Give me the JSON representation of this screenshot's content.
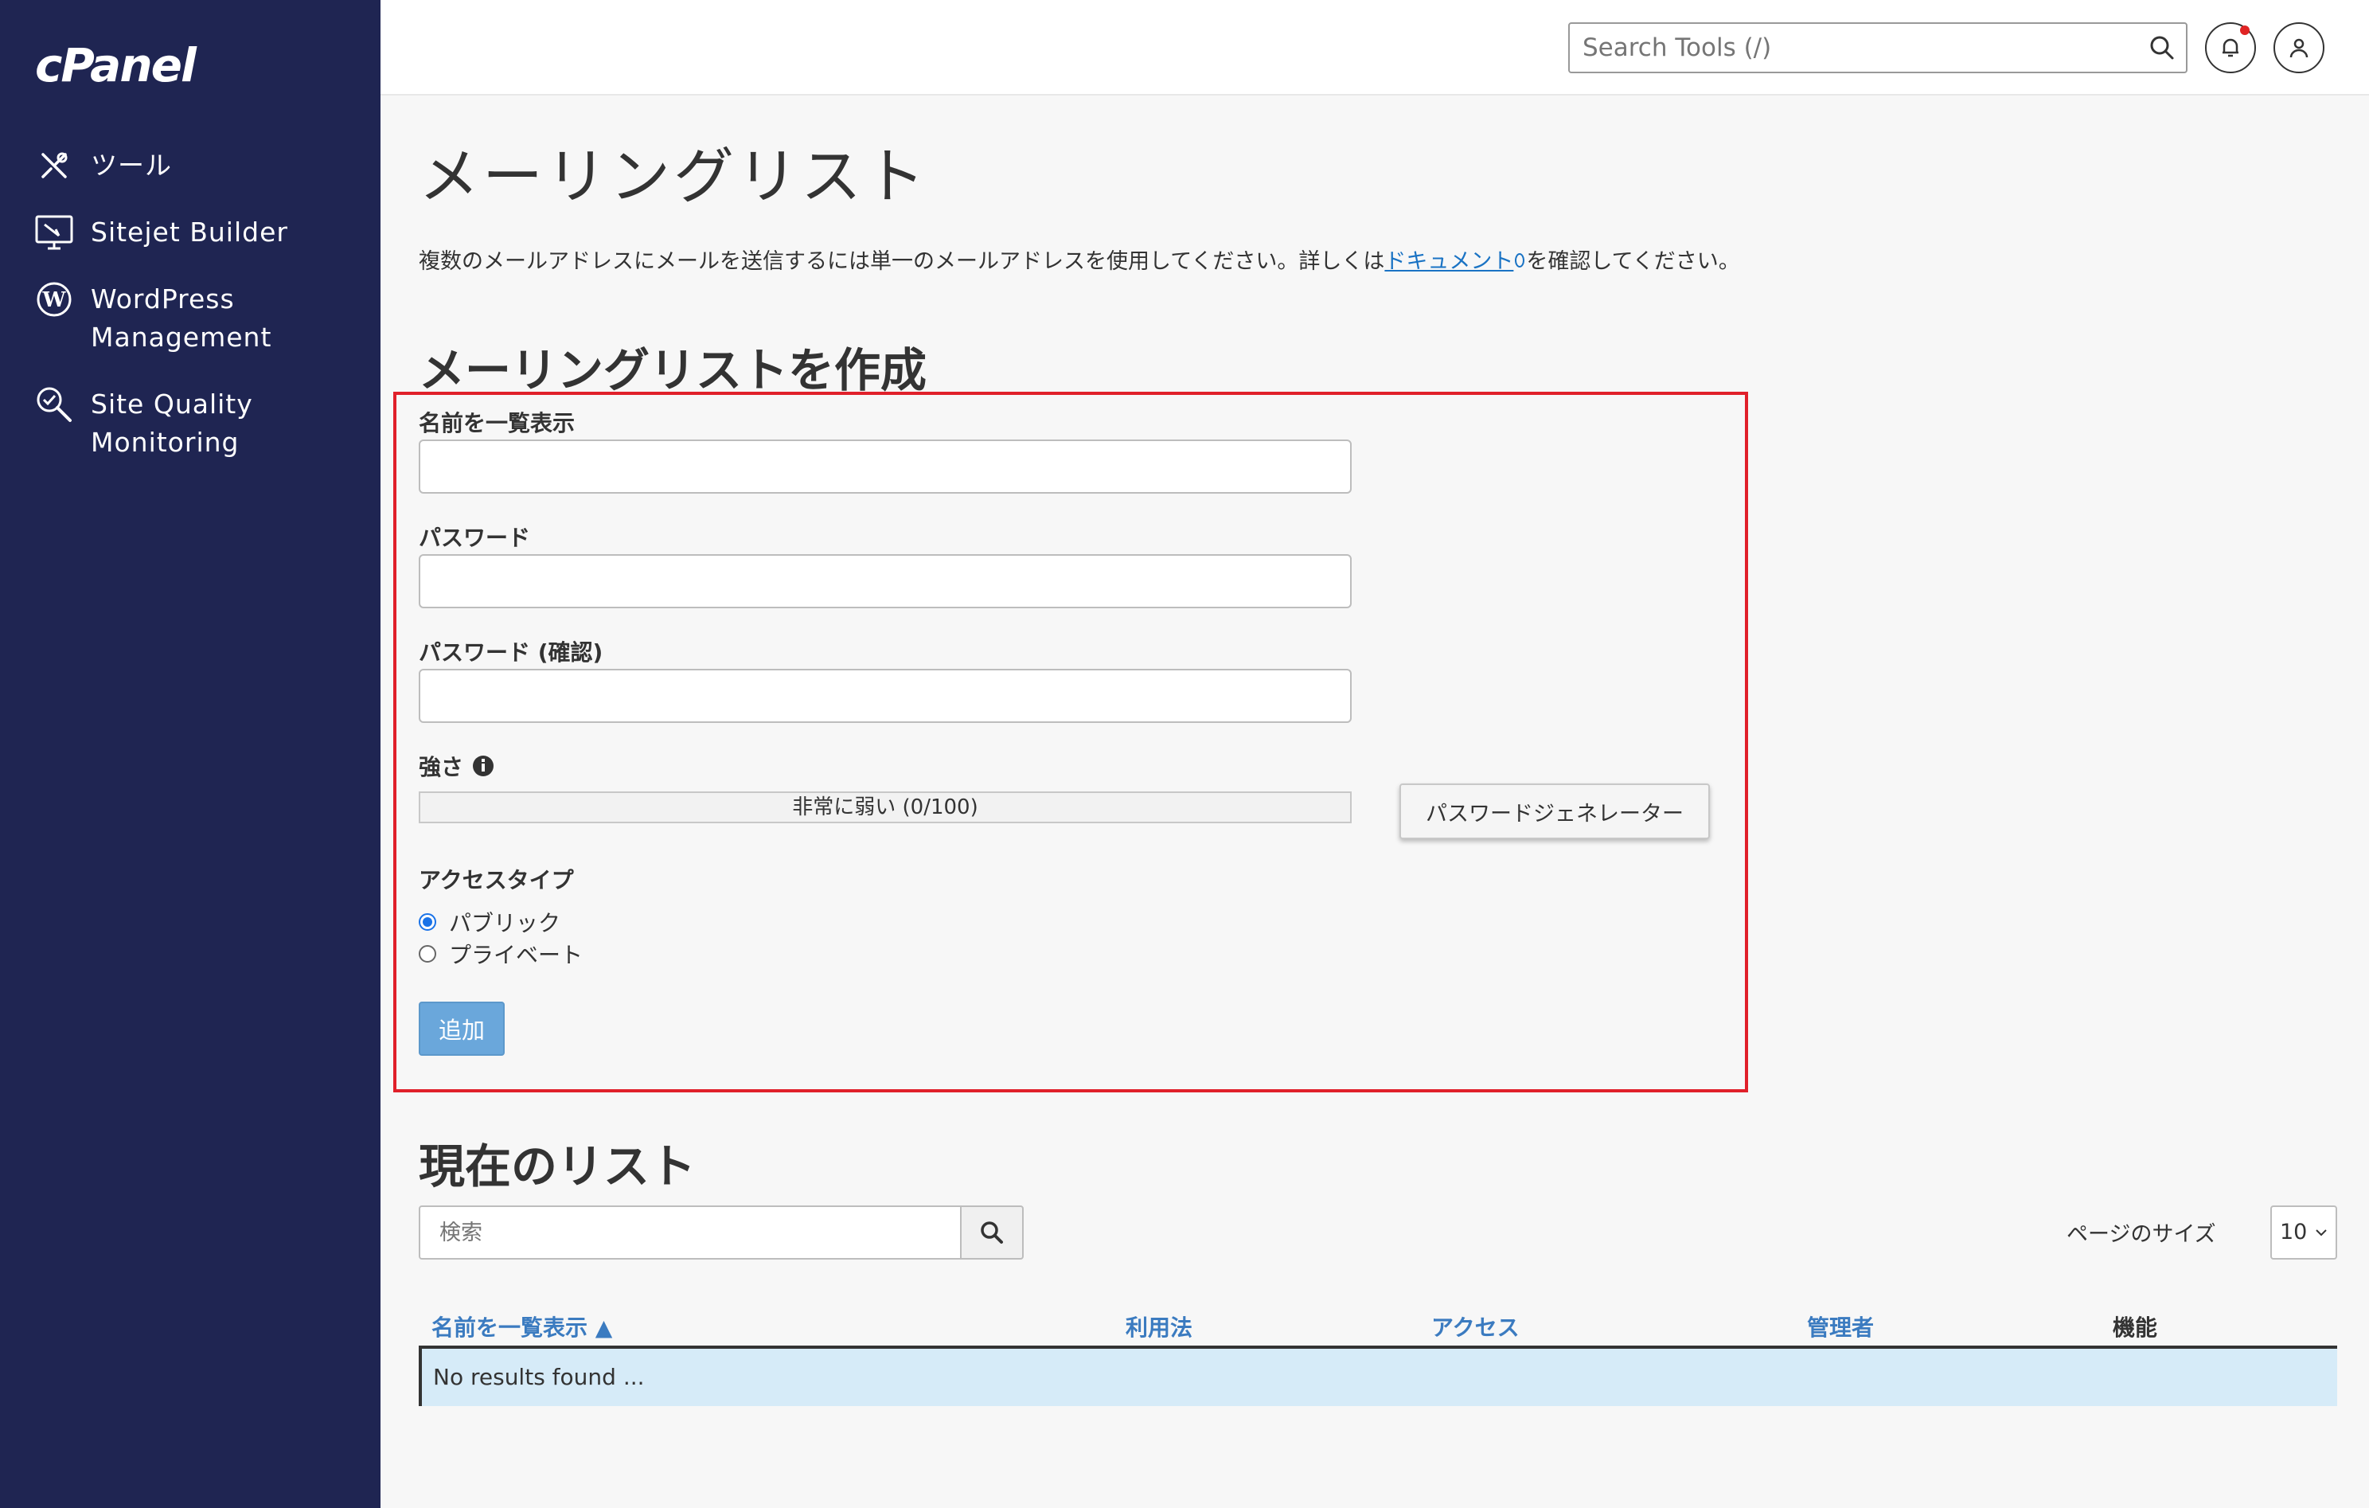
{
  "sidebar": {
    "logo": "cPanel",
    "items": [
      {
        "label": "ツール",
        "icon": "tools-icon"
      },
      {
        "label": "Sitejet Builder",
        "icon": "sitejet-icon"
      },
      {
        "label": "WordPress Management",
        "icon": "wordpress-icon"
      },
      {
        "label": "Site Quality Monitoring",
        "icon": "site-quality-icon"
      }
    ]
  },
  "header": {
    "search_placeholder": "Search Tools (/)"
  },
  "page": {
    "title": "メーリングリスト",
    "intro_before": "複数のメールアドレスにメールを送信するには単一のメールアドレスを使用してください。詳しくは",
    "intro_link": "ドキュメント",
    "intro_after": "を確認してください。"
  },
  "create": {
    "title": "メーリングリストを作成",
    "name_label": "名前を一覧表示",
    "password_label": "パスワード",
    "password_confirm_label": "パスワード (確認)",
    "strength_label": "強さ",
    "strength_text": "非常に弱い (0/100)",
    "strength_value": 0,
    "password_generator": "パスワードジェネレーター",
    "access_type_label": "アクセスタイプ",
    "access_public": "パブリック",
    "access_private": "プライベート",
    "selected_access": "public",
    "add_button": "追加"
  },
  "current": {
    "title": "現在のリスト",
    "search_placeholder": "検索",
    "page_size_label": "ページのサイズ",
    "page_size_value": "10",
    "columns": [
      "名前を一覧表示 ▲",
      "利用法",
      "アクセス",
      "管理者",
      "機能"
    ],
    "no_results": "No results found ..."
  },
  "colors": {
    "sidebar_bg": "#1f2552",
    "link": "#1a73c4",
    "highlight_border": "#e0202a",
    "add_button": "#6aa7db",
    "no_results_bg": "#d6ebf8"
  }
}
